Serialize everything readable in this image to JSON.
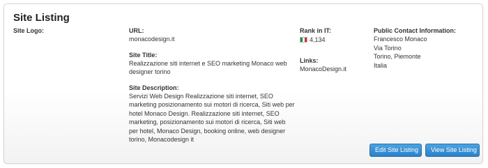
{
  "panel": {
    "title": "Site Listing",
    "site_logo_label": "Site Logo:"
  },
  "details": {
    "url_label": "URL:",
    "url_value": "monacodesign.it",
    "site_title_label": "Site Title:",
    "site_title_value": "Realizzazione siti internet e SEO marketing Monaco web designer torino",
    "site_description_label": "Site Description:",
    "site_description_value": "Servizi Web Design Realizzazione siti internet, SEO marketing posizionamento sui motori di ricerca, Siti web per hotel Monaco Design. Realizzazione siti internet, SEO marketing, posizionamento sui motori di ricerca, Siti web per hotel, Monaco Design, booking online, web designer torino, Monacodesign it"
  },
  "rank": {
    "label": "Rank in IT:",
    "value": "4,134",
    "flag_icon": "italy-flag-icon",
    "flag_colors": [
      "#009246",
      "#ffffff",
      "#ce2b37"
    ]
  },
  "links": {
    "label": "Links:",
    "value": "MonacoDesign.it"
  },
  "contact": {
    "label": "Public Contact Information:",
    "lines": [
      "Francesco Monaco",
      "Via Torino",
      "Torino, Piemonte",
      "Italia"
    ]
  },
  "buttons": {
    "edit_label": "Edit Site Listing",
    "view_label": "View Site Listing",
    "accent_color": "#2a82c9"
  }
}
